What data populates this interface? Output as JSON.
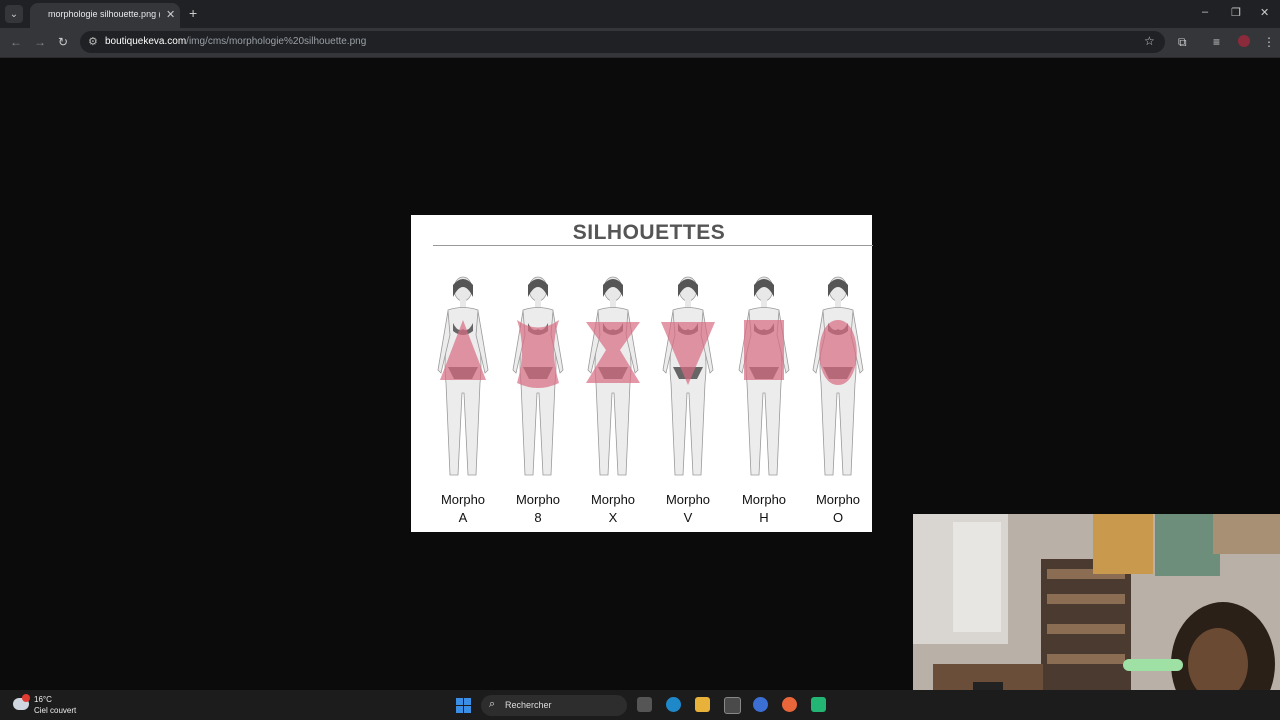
{
  "browser": {
    "tab_title": "morphologie silhouette.png (6",
    "tab_close": "✕",
    "new_tab": "+",
    "url_host": "boutiquekeva.com",
    "url_path": "/img/cms/morphologie%20silhouette.png",
    "window": {
      "minimize": "–",
      "restore": "❐",
      "close": "✕"
    }
  },
  "image": {
    "title": "SILHOUETTES",
    "figures": [
      {
        "line1": "Morpho",
        "line2": "A",
        "shape": "triangle-up"
      },
      {
        "line1": "Morpho",
        "line2": "8",
        "shape": "eight"
      },
      {
        "line1": "Morpho",
        "line2": "X",
        "shape": "x"
      },
      {
        "line1": "Morpho",
        "line2": "V",
        "shape": "triangle-down"
      },
      {
        "line1": "Morpho",
        "line2": "H",
        "shape": "rect"
      },
      {
        "line1": "Morpho",
        "line2": "O",
        "shape": "oval"
      }
    ],
    "shape_color": "#d96b80"
  },
  "taskbar": {
    "temperature": "16°C",
    "condition": "Ciel couvert",
    "search_label": "Rechercher"
  }
}
